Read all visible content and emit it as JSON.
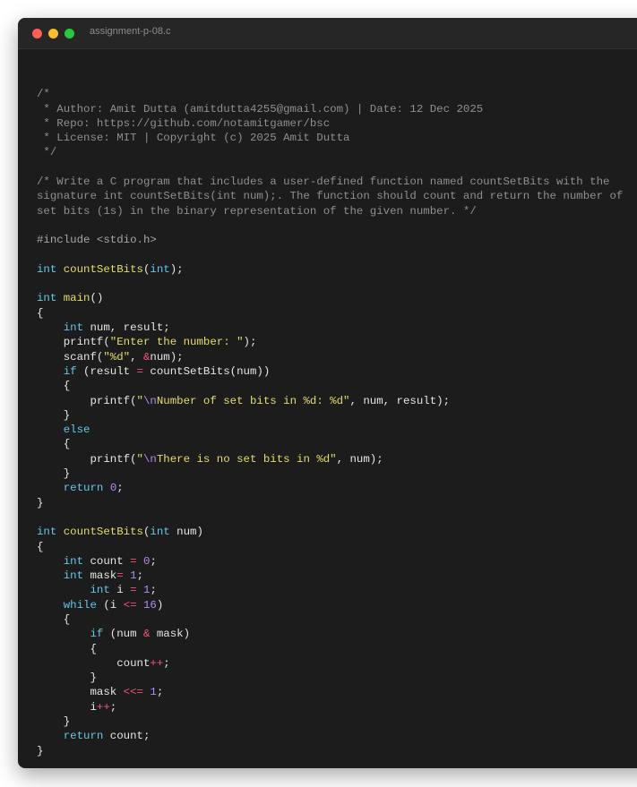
{
  "window": {
    "title": "assignment-p-08.c",
    "colors": {
      "close": "#ff5f57",
      "minimize": "#febc2e",
      "maximize": "#28c840",
      "background": "#1c1c1c"
    }
  },
  "editor": {
    "language": "c",
    "lines": [
      [],
      [
        {
          "t": "cm",
          "v": "/*"
        }
      ],
      [
        {
          "t": "cm",
          "v": " * Author: Amit Dutta (amitdutta4255@gmail.com) | Date: 12 Dec 2025"
        }
      ],
      [
        {
          "t": "cm",
          "v": " * Repo: https://github.com/notamitgamer/bsc"
        }
      ],
      [
        {
          "t": "cm",
          "v": " * License: MIT | Copyright (c) 2025 Amit Dutta"
        }
      ],
      [
        {
          "t": "cm",
          "v": " */"
        }
      ],
      [],
      [
        {
          "t": "cm",
          "v": "/* Write a C program that includes a user-defined function named countSetBits with the"
        }
      ],
      [
        {
          "t": "cm",
          "v": "signature int countSetBits(int num);. The function should count and return the number of"
        }
      ],
      [
        {
          "t": "cm",
          "v": "set bits (1s) in the binary representation of the given number. */"
        }
      ],
      [],
      [
        {
          "t": "pp",
          "v": "#include <stdio.h>"
        }
      ],
      [],
      [
        {
          "t": "kw",
          "v": "int"
        },
        {
          "t": "tx",
          "v": " "
        },
        {
          "t": "fn",
          "v": "countSetBits"
        },
        {
          "t": "tx",
          "v": "("
        },
        {
          "t": "kw",
          "v": "int"
        },
        {
          "t": "tx",
          "v": ");"
        }
      ],
      [],
      [
        {
          "t": "kw",
          "v": "int"
        },
        {
          "t": "tx",
          "v": " "
        },
        {
          "t": "fn",
          "v": "main"
        },
        {
          "t": "tx",
          "v": "()"
        }
      ],
      [
        {
          "t": "tx",
          "v": "{"
        }
      ],
      [
        {
          "t": "tx",
          "v": "    "
        },
        {
          "t": "kw",
          "v": "int"
        },
        {
          "t": "tx",
          "v": " num, result;"
        }
      ],
      [
        {
          "t": "tx",
          "v": "    printf("
        },
        {
          "t": "str",
          "v": "\"Enter the number: \""
        },
        {
          "t": "tx",
          "v": ");"
        }
      ],
      [
        {
          "t": "tx",
          "v": "    scanf("
        },
        {
          "t": "str",
          "v": "\"%d\""
        },
        {
          "t": "tx",
          "v": ", "
        },
        {
          "t": "op",
          "v": "&"
        },
        {
          "t": "tx",
          "v": "num);"
        }
      ],
      [
        {
          "t": "tx",
          "v": "    "
        },
        {
          "t": "kw",
          "v": "if"
        },
        {
          "t": "tx",
          "v": " (result "
        },
        {
          "t": "op",
          "v": "="
        },
        {
          "t": "tx",
          "v": " countSetBits(num))"
        }
      ],
      [
        {
          "t": "tx",
          "v": "    {"
        }
      ],
      [
        {
          "t": "tx",
          "v": "        printf("
        },
        {
          "t": "str",
          "v": "\""
        },
        {
          "t": "esc",
          "v": "\\n"
        },
        {
          "t": "str",
          "v": "Number of set bits in %d: %d\""
        },
        {
          "t": "tx",
          "v": ", num, result);"
        }
      ],
      [
        {
          "t": "tx",
          "v": "    }"
        }
      ],
      [
        {
          "t": "tx",
          "v": "    "
        },
        {
          "t": "kw",
          "v": "else"
        }
      ],
      [
        {
          "t": "tx",
          "v": "    {"
        }
      ],
      [
        {
          "t": "tx",
          "v": "        printf("
        },
        {
          "t": "str",
          "v": "\""
        },
        {
          "t": "esc",
          "v": "\\n"
        },
        {
          "t": "str",
          "v": "There is no set bits in %d\""
        },
        {
          "t": "tx",
          "v": ", num);"
        }
      ],
      [
        {
          "t": "tx",
          "v": "    }"
        }
      ],
      [
        {
          "t": "tx",
          "v": "    "
        },
        {
          "t": "kw",
          "v": "return"
        },
        {
          "t": "tx",
          "v": " "
        },
        {
          "t": "num",
          "v": "0"
        },
        {
          "t": "tx",
          "v": ";"
        }
      ],
      [
        {
          "t": "tx",
          "v": "}"
        }
      ],
      [],
      [
        {
          "t": "kw",
          "v": "int"
        },
        {
          "t": "tx",
          "v": " "
        },
        {
          "t": "fn",
          "v": "countSetBits"
        },
        {
          "t": "tx",
          "v": "("
        },
        {
          "t": "kw",
          "v": "int"
        },
        {
          "t": "tx",
          "v": " num)"
        }
      ],
      [
        {
          "t": "tx",
          "v": "{"
        }
      ],
      [
        {
          "t": "tx",
          "v": "    "
        },
        {
          "t": "kw",
          "v": "int"
        },
        {
          "t": "tx",
          "v": " count "
        },
        {
          "t": "op",
          "v": "="
        },
        {
          "t": "tx",
          "v": " "
        },
        {
          "t": "num",
          "v": "0"
        },
        {
          "t": "tx",
          "v": ";"
        }
      ],
      [
        {
          "t": "tx",
          "v": "    "
        },
        {
          "t": "kw",
          "v": "int"
        },
        {
          "t": "tx",
          "v": " mask"
        },
        {
          "t": "op",
          "v": "="
        },
        {
          "t": "tx",
          "v": " "
        },
        {
          "t": "num",
          "v": "1"
        },
        {
          "t": "tx",
          "v": ";"
        }
      ],
      [
        {
          "t": "tx",
          "v": "        "
        },
        {
          "t": "kw",
          "v": "int"
        },
        {
          "t": "tx",
          "v": " i "
        },
        {
          "t": "op",
          "v": "="
        },
        {
          "t": "tx",
          "v": " "
        },
        {
          "t": "num",
          "v": "1"
        },
        {
          "t": "tx",
          "v": ";"
        }
      ],
      [
        {
          "t": "tx",
          "v": "    "
        },
        {
          "t": "kw",
          "v": "while"
        },
        {
          "t": "tx",
          "v": " (i "
        },
        {
          "t": "op",
          "v": "<="
        },
        {
          "t": "tx",
          "v": " "
        },
        {
          "t": "num",
          "v": "16"
        },
        {
          "t": "tx",
          "v": ")"
        }
      ],
      [
        {
          "t": "tx",
          "v": "    {"
        }
      ],
      [
        {
          "t": "tx",
          "v": "        "
        },
        {
          "t": "kw",
          "v": "if"
        },
        {
          "t": "tx",
          "v": " (num "
        },
        {
          "t": "op",
          "v": "&"
        },
        {
          "t": "tx",
          "v": " mask)"
        }
      ],
      [
        {
          "t": "tx",
          "v": "        {"
        }
      ],
      [
        {
          "t": "tx",
          "v": "            count"
        },
        {
          "t": "op",
          "v": "++"
        },
        {
          "t": "tx",
          "v": ";"
        }
      ],
      [
        {
          "t": "tx",
          "v": "        }"
        }
      ],
      [
        {
          "t": "tx",
          "v": "        mask "
        },
        {
          "t": "op",
          "v": "<<="
        },
        {
          "t": "tx",
          "v": " "
        },
        {
          "t": "num",
          "v": "1"
        },
        {
          "t": "tx",
          "v": ";"
        }
      ],
      [
        {
          "t": "tx",
          "v": "        i"
        },
        {
          "t": "op",
          "v": "++"
        },
        {
          "t": "tx",
          "v": ";"
        }
      ],
      [
        {
          "t": "tx",
          "v": "    }"
        }
      ],
      [
        {
          "t": "tx",
          "v": "    "
        },
        {
          "t": "kw",
          "v": "return"
        },
        {
          "t": "tx",
          "v": " count;"
        }
      ],
      [
        {
          "t": "tx",
          "v": "}"
        }
      ]
    ]
  }
}
